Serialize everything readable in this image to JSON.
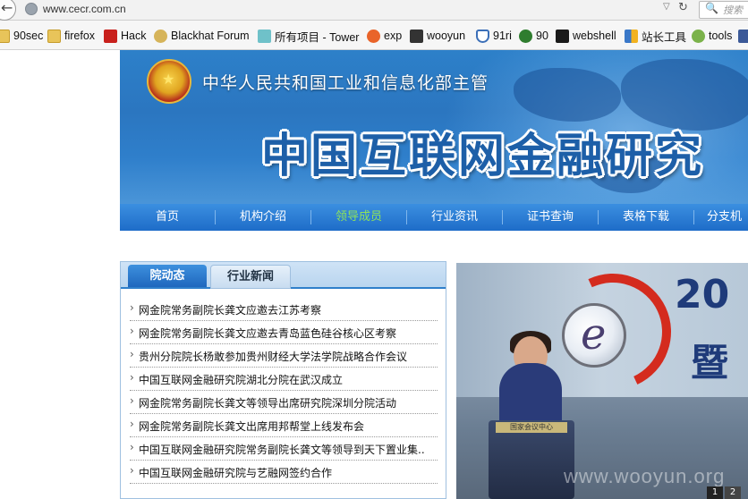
{
  "browser": {
    "url": "www.cecr.com.cn",
    "search_placeholder": "搜索",
    "bookmarks": [
      {
        "label": "90sec",
        "icon": "folder-icon"
      },
      {
        "label": "firefox",
        "icon": "folder-icon"
      },
      {
        "label": "Hack",
        "icon": "skull-icon"
      },
      {
        "label": "Blackhat Forum",
        "icon": "badge-icon"
      },
      {
        "label": "所有项目 - Tower",
        "icon": "tower-icon"
      },
      {
        "label": "exp",
        "icon": "flame-icon"
      },
      {
        "label": "wooyun",
        "icon": "wooyun-icon"
      },
      {
        "label": "91ri",
        "icon": "shield-icon"
      },
      {
        "label": "90",
        "icon": "bug-icon"
      },
      {
        "label": "webshell",
        "icon": "terminal-icon"
      },
      {
        "label": "站长工具",
        "icon": "chart-icon"
      },
      {
        "label": "tools",
        "icon": "leaf-icon"
      }
    ]
  },
  "site": {
    "ministry": "中华人民共和国工业和信息化部主管",
    "title": "中国互联网金融研究",
    "nav": [
      "首页",
      "机构介绍",
      "领导成员",
      "行业资讯",
      "证书查询",
      "表格下载",
      "分支机"
    ],
    "nav_active_index": 2,
    "news_tabs": [
      "院动态",
      "行业新闻"
    ],
    "news": [
      "网金院常务副院长龚文应邀去江苏考察",
      "网金院常务副院长龚文应邀去青岛蓝色硅谷核心区考察",
      "贵州分院院长杨敢参加贵州财经大学法学院战略合作会议",
      "中国互联网金融研究院湖北分院在武汉成立",
      "网金院常务副院长龚文等领导出席研究院深圳分院活动",
      "网金院常务副院长龚文出席用邦帮堂上线发布会",
      "中国互联网金融研究院常务副院长龚文等领导到天下置业集..",
      "中国互联网金融研究院与艺融网签约合作"
    ],
    "photo": {
      "headline1": "20",
      "headline2": "暨",
      "podium_label": "国家会议中心",
      "watermark": "www.wooyun.org",
      "pages": [
        "1",
        "2"
      ]
    }
  }
}
